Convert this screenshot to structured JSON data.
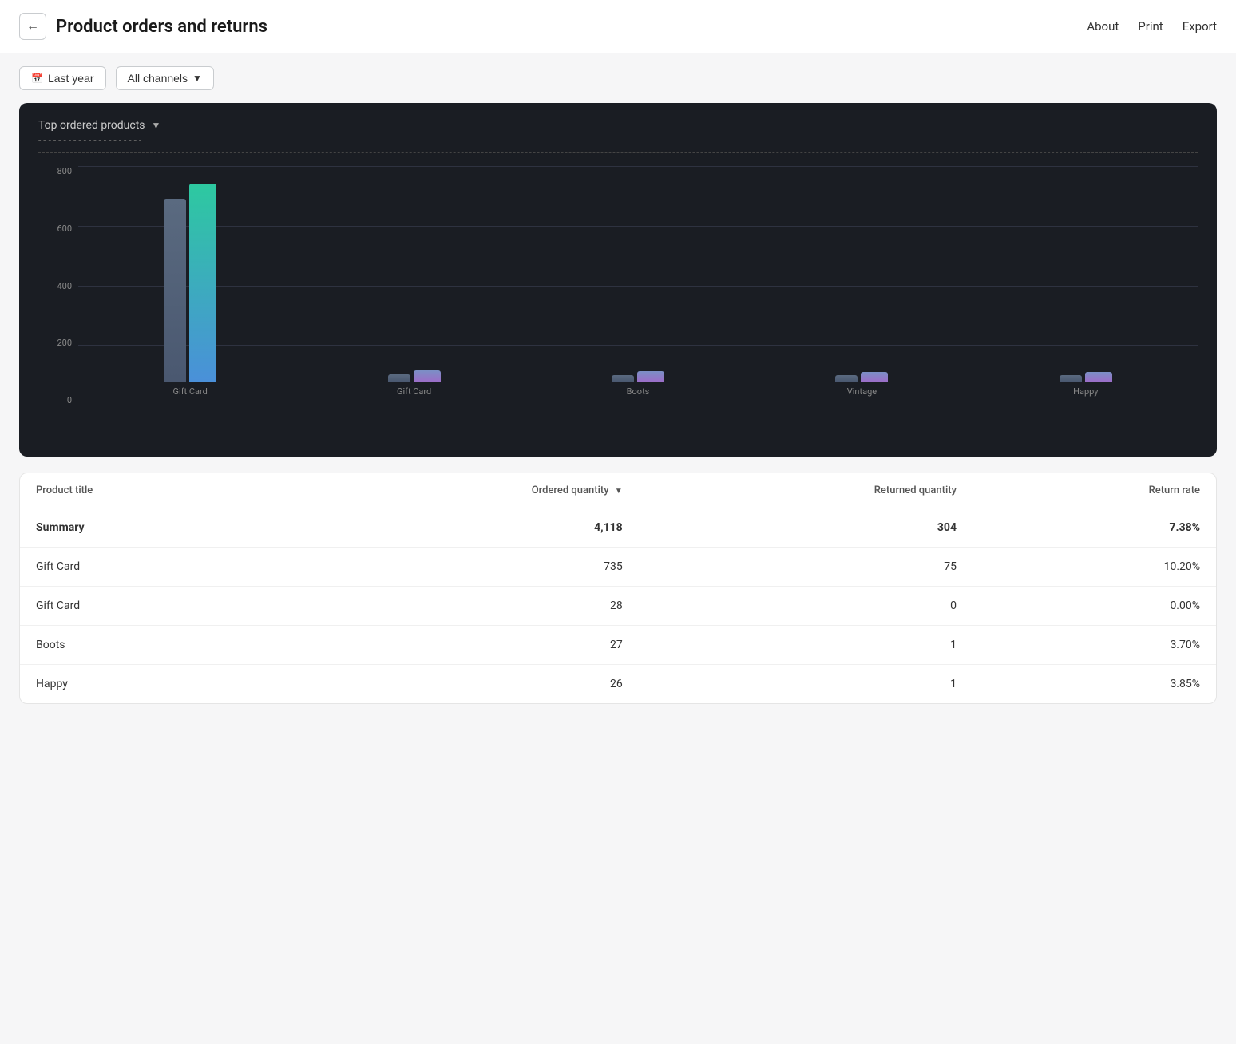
{
  "header": {
    "back_label": "←",
    "title": "Product orders and returns",
    "nav_links": [
      "About",
      "Print",
      "Export"
    ]
  },
  "filters": {
    "date_label": "Last year",
    "date_icon": "📅",
    "channel_label": "All channels",
    "channel_icon": "▼"
  },
  "chart": {
    "title": "Top ordered products",
    "subtitle": "- - - - - - - - - - - - - - - - -",
    "y_labels": [
      "800",
      "600",
      "400",
      "200",
      "0"
    ],
    "bars": [
      {
        "label": "Gift Card",
        "ordered": 735,
        "returned": 75,
        "max": 800,
        "ordered_pct": 91.9,
        "returned_pct": 9.4
      },
      {
        "label": "Gift Card",
        "ordered": 28,
        "returned": 0,
        "max": 800,
        "ordered_pct": 3.5,
        "returned_pct": 0
      },
      {
        "label": "Boots",
        "ordered": 27,
        "returned": 1,
        "max": 800,
        "ordered_pct": 3.4,
        "returned_pct": 0.1
      },
      {
        "label": "Vintage",
        "ordered": 26,
        "returned": 1,
        "max": 800,
        "ordered_pct": 3.25,
        "returned_pct": 0.1
      },
      {
        "label": "Happy",
        "ordered": 25,
        "returned": 1,
        "max": 800,
        "ordered_pct": 3.1,
        "returned_pct": 0.1
      }
    ]
  },
  "table": {
    "columns": [
      "Product title",
      "Ordered quantity",
      "Returned quantity",
      "Return rate"
    ],
    "sort_col": "Ordered quantity",
    "rows": [
      {
        "is_summary": true,
        "product": "Summary",
        "ordered": "4,118",
        "returned": "304",
        "rate": "7.38%"
      },
      {
        "is_summary": false,
        "product": "Gift Card",
        "ordered": "735",
        "returned": "75",
        "rate": "10.20%"
      },
      {
        "is_summary": false,
        "product": "Gift Card",
        "ordered": "28",
        "returned": "0",
        "rate": "0.00%"
      },
      {
        "is_summary": false,
        "product": "Boots",
        "ordered": "27",
        "returned": "1",
        "rate": "3.70%"
      },
      {
        "is_summary": false,
        "product": "Happy",
        "ordered": "26",
        "returned": "1",
        "rate": "3.85%"
      }
    ]
  }
}
